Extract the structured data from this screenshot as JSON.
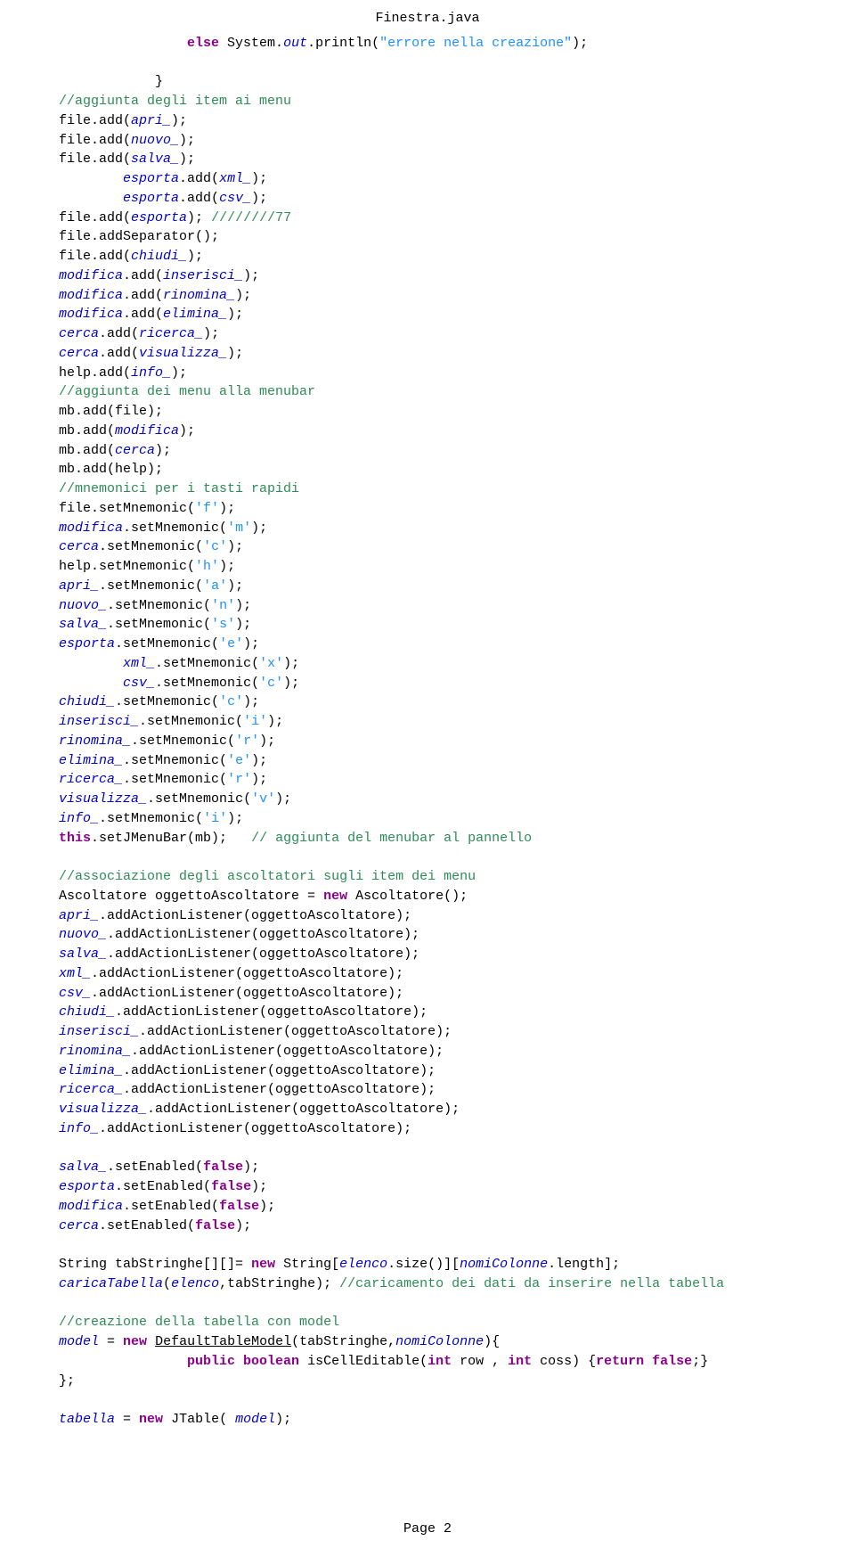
{
  "title": "Finestra.java",
  "footer": "Page 2",
  "code": {
    "lines": [
      {
        "indent": 5,
        "tokens": [
          {
            "t": "else",
            "c": "keyword"
          },
          {
            "t": " System."
          },
          {
            "t": "out",
            "c": "field"
          },
          {
            "t": ".println("
          },
          {
            "t": "\"errore nella creazione\"",
            "c": "string"
          },
          {
            "t": ");"
          }
        ]
      },
      {
        "indent": 0,
        "tokens": []
      },
      {
        "indent": 4,
        "tokens": [
          {
            "t": "}"
          }
        ]
      },
      {
        "indent": 1,
        "tokens": [
          {
            "t": "//aggiunta degli item ai menu",
            "c": "comment"
          }
        ]
      },
      {
        "indent": 1,
        "tokens": [
          {
            "t": "file.add("
          },
          {
            "t": "apri_",
            "c": "field"
          },
          {
            "t": ");"
          }
        ]
      },
      {
        "indent": 1,
        "tokens": [
          {
            "t": "file.add("
          },
          {
            "t": "nuovo_",
            "c": "field"
          },
          {
            "t": ");"
          }
        ]
      },
      {
        "indent": 1,
        "tokens": [
          {
            "t": "file.add("
          },
          {
            "t": "salva_",
            "c": "field"
          },
          {
            "t": ");"
          }
        ]
      },
      {
        "indent": 3,
        "tokens": [
          {
            "t": "esporta",
            "c": "field"
          },
          {
            "t": ".add("
          },
          {
            "t": "xml_",
            "c": "field"
          },
          {
            "t": ");"
          }
        ]
      },
      {
        "indent": 3,
        "tokens": [
          {
            "t": "esporta",
            "c": "field"
          },
          {
            "t": ".add("
          },
          {
            "t": "csv_",
            "c": "field"
          },
          {
            "t": ");"
          }
        ]
      },
      {
        "indent": 1,
        "tokens": [
          {
            "t": "file.add("
          },
          {
            "t": "esporta",
            "c": "field"
          },
          {
            "t": "); "
          },
          {
            "t": "////////77",
            "c": "comment"
          }
        ]
      },
      {
        "indent": 1,
        "tokens": [
          {
            "t": "file.addSeparator();"
          }
        ]
      },
      {
        "indent": 1,
        "tokens": [
          {
            "t": "file.add("
          },
          {
            "t": "chiudi_",
            "c": "field"
          },
          {
            "t": ");"
          }
        ]
      },
      {
        "indent": 1,
        "tokens": [
          {
            "t": "modifica",
            "c": "field"
          },
          {
            "t": ".add("
          },
          {
            "t": "inserisci_",
            "c": "field"
          },
          {
            "t": ");"
          }
        ]
      },
      {
        "indent": 1,
        "tokens": [
          {
            "t": "modifica",
            "c": "field"
          },
          {
            "t": ".add("
          },
          {
            "t": "rinomina_",
            "c": "field"
          },
          {
            "t": ");"
          }
        ]
      },
      {
        "indent": 1,
        "tokens": [
          {
            "t": "modifica",
            "c": "field"
          },
          {
            "t": ".add("
          },
          {
            "t": "elimina_",
            "c": "field"
          },
          {
            "t": ");"
          }
        ]
      },
      {
        "indent": 1,
        "tokens": [
          {
            "t": "cerca",
            "c": "field"
          },
          {
            "t": ".add("
          },
          {
            "t": "ricerca_",
            "c": "field"
          },
          {
            "t": ");"
          }
        ]
      },
      {
        "indent": 1,
        "tokens": [
          {
            "t": "cerca",
            "c": "field"
          },
          {
            "t": ".add("
          },
          {
            "t": "visualizza_",
            "c": "field"
          },
          {
            "t": ");"
          }
        ]
      },
      {
        "indent": 1,
        "tokens": [
          {
            "t": "help.add("
          },
          {
            "t": "info_",
            "c": "field"
          },
          {
            "t": ");"
          }
        ]
      },
      {
        "indent": 1,
        "tokens": [
          {
            "t": "//aggiunta dei menu alla menubar",
            "c": "comment"
          }
        ]
      },
      {
        "indent": 1,
        "tokens": [
          {
            "t": "mb.add(file);"
          }
        ]
      },
      {
        "indent": 1,
        "tokens": [
          {
            "t": "mb.add("
          },
          {
            "t": "modifica",
            "c": "field"
          },
          {
            "t": ");"
          }
        ]
      },
      {
        "indent": 1,
        "tokens": [
          {
            "t": "mb.add("
          },
          {
            "t": "cerca",
            "c": "field"
          },
          {
            "t": ");"
          }
        ]
      },
      {
        "indent": 1,
        "tokens": [
          {
            "t": "mb.add(help);"
          }
        ]
      },
      {
        "indent": 1,
        "tokens": [
          {
            "t": "//mnemonici per i tasti rapidi",
            "c": "comment"
          }
        ]
      },
      {
        "indent": 1,
        "tokens": [
          {
            "t": "file.setMnemonic("
          },
          {
            "t": "'f'",
            "c": "string"
          },
          {
            "t": ");"
          }
        ]
      },
      {
        "indent": 1,
        "tokens": [
          {
            "t": "modifica",
            "c": "field"
          },
          {
            "t": ".setMnemonic("
          },
          {
            "t": "'m'",
            "c": "string"
          },
          {
            "t": ");"
          }
        ]
      },
      {
        "indent": 1,
        "tokens": [
          {
            "t": "cerca",
            "c": "field"
          },
          {
            "t": ".setMnemonic("
          },
          {
            "t": "'c'",
            "c": "string"
          },
          {
            "t": ");"
          }
        ]
      },
      {
        "indent": 1,
        "tokens": [
          {
            "t": "help.setMnemonic("
          },
          {
            "t": "'h'",
            "c": "string"
          },
          {
            "t": ");"
          }
        ]
      },
      {
        "indent": 1,
        "tokens": [
          {
            "t": "apri_",
            "c": "field"
          },
          {
            "t": ".setMnemonic("
          },
          {
            "t": "'a'",
            "c": "string"
          },
          {
            "t": ");"
          }
        ]
      },
      {
        "indent": 1,
        "tokens": [
          {
            "t": "nuovo_",
            "c": "field"
          },
          {
            "t": ".setMnemonic("
          },
          {
            "t": "'n'",
            "c": "string"
          },
          {
            "t": ");"
          }
        ]
      },
      {
        "indent": 1,
        "tokens": [
          {
            "t": "salva_",
            "c": "field"
          },
          {
            "t": ".setMnemonic("
          },
          {
            "t": "'s'",
            "c": "string"
          },
          {
            "t": ");"
          }
        ]
      },
      {
        "indent": 1,
        "tokens": [
          {
            "t": "esporta",
            "c": "field"
          },
          {
            "t": ".setMnemonic("
          },
          {
            "t": "'e'",
            "c": "string"
          },
          {
            "t": ");"
          }
        ]
      },
      {
        "indent": 3,
        "tokens": [
          {
            "t": "xml_",
            "c": "field"
          },
          {
            "t": ".setMnemonic("
          },
          {
            "t": "'x'",
            "c": "string"
          },
          {
            "t": ");"
          }
        ]
      },
      {
        "indent": 3,
        "tokens": [
          {
            "t": "csv_",
            "c": "field"
          },
          {
            "t": ".setMnemonic("
          },
          {
            "t": "'c'",
            "c": "string"
          },
          {
            "t": ");"
          }
        ]
      },
      {
        "indent": 1,
        "tokens": [
          {
            "t": "chiudi_",
            "c": "field"
          },
          {
            "t": ".setMnemonic("
          },
          {
            "t": "'c'",
            "c": "string"
          },
          {
            "t": ");"
          }
        ]
      },
      {
        "indent": 1,
        "tokens": [
          {
            "t": "inserisci_",
            "c": "field"
          },
          {
            "t": ".setMnemonic("
          },
          {
            "t": "'i'",
            "c": "string"
          },
          {
            "t": ");"
          }
        ]
      },
      {
        "indent": 1,
        "tokens": [
          {
            "t": "rinomina_",
            "c": "field"
          },
          {
            "t": ".setMnemonic("
          },
          {
            "t": "'r'",
            "c": "string"
          },
          {
            "t": ");"
          }
        ]
      },
      {
        "indent": 1,
        "tokens": [
          {
            "t": "elimina_",
            "c": "field"
          },
          {
            "t": ".setMnemonic("
          },
          {
            "t": "'e'",
            "c": "string"
          },
          {
            "t": ");"
          }
        ]
      },
      {
        "indent": 1,
        "tokens": [
          {
            "t": "ricerca_",
            "c": "field"
          },
          {
            "t": ".setMnemonic("
          },
          {
            "t": "'r'",
            "c": "string"
          },
          {
            "t": ");"
          }
        ]
      },
      {
        "indent": 1,
        "tokens": [
          {
            "t": "visualizza_",
            "c": "field"
          },
          {
            "t": ".setMnemonic("
          },
          {
            "t": "'v'",
            "c": "string"
          },
          {
            "t": ");"
          }
        ]
      },
      {
        "indent": 1,
        "tokens": [
          {
            "t": "info_",
            "c": "field"
          },
          {
            "t": ".setMnemonic("
          },
          {
            "t": "'i'",
            "c": "string"
          },
          {
            "t": ");"
          }
        ]
      },
      {
        "indent": 1,
        "tokens": [
          {
            "t": "this",
            "c": "keyword"
          },
          {
            "t": ".setJMenuBar(mb);   "
          },
          {
            "t": "// aggiunta del menubar al pannello",
            "c": "comment"
          }
        ]
      },
      {
        "indent": 0,
        "tokens": []
      },
      {
        "indent": 1,
        "tokens": [
          {
            "t": "//associazione degli ascoltatori sugli item dei menu",
            "c": "comment"
          }
        ]
      },
      {
        "indent": 1,
        "tokens": [
          {
            "t": "Ascoltatore oggettoAscoltatore = "
          },
          {
            "t": "new",
            "c": "keyword"
          },
          {
            "t": " Ascoltatore();"
          }
        ]
      },
      {
        "indent": 1,
        "tokens": [
          {
            "t": "apri_",
            "c": "field"
          },
          {
            "t": ".addActionListener(oggettoAscoltatore);"
          }
        ]
      },
      {
        "indent": 1,
        "tokens": [
          {
            "t": "nuovo_",
            "c": "field"
          },
          {
            "t": ".addActionListener(oggettoAscoltatore);"
          }
        ]
      },
      {
        "indent": 1,
        "tokens": [
          {
            "t": "salva_",
            "c": "field"
          },
          {
            "t": ".addActionListener(oggettoAscoltatore);"
          }
        ]
      },
      {
        "indent": 1,
        "tokens": [
          {
            "t": "xml_",
            "c": "field"
          },
          {
            "t": ".addActionListener(oggettoAscoltatore);"
          }
        ]
      },
      {
        "indent": 1,
        "tokens": [
          {
            "t": "csv_",
            "c": "field"
          },
          {
            "t": ".addActionListener(oggettoAscoltatore);"
          }
        ]
      },
      {
        "indent": 1,
        "tokens": [
          {
            "t": "chiudi_",
            "c": "field"
          },
          {
            "t": ".addActionListener(oggettoAscoltatore);"
          }
        ]
      },
      {
        "indent": 1,
        "tokens": [
          {
            "t": "inserisci_",
            "c": "field"
          },
          {
            "t": ".addActionListener(oggettoAscoltatore);"
          }
        ]
      },
      {
        "indent": 1,
        "tokens": [
          {
            "t": "rinomina_",
            "c": "field"
          },
          {
            "t": ".addActionListener(oggettoAscoltatore);"
          }
        ]
      },
      {
        "indent": 1,
        "tokens": [
          {
            "t": "elimina_",
            "c": "field"
          },
          {
            "t": ".addActionListener(oggettoAscoltatore);"
          }
        ]
      },
      {
        "indent": 1,
        "tokens": [
          {
            "t": "ricerca_",
            "c": "field"
          },
          {
            "t": ".addActionListener(oggettoAscoltatore);"
          }
        ]
      },
      {
        "indent": 1,
        "tokens": [
          {
            "t": "visualizza_",
            "c": "field"
          },
          {
            "t": ".addActionListener(oggettoAscoltatore);"
          }
        ]
      },
      {
        "indent": 1,
        "tokens": [
          {
            "t": "info_",
            "c": "field"
          },
          {
            "t": ".addActionListener(oggettoAscoltatore);"
          }
        ]
      },
      {
        "indent": 0,
        "tokens": []
      },
      {
        "indent": 1,
        "tokens": [
          {
            "t": "salva_",
            "c": "field"
          },
          {
            "t": ".setEnabled("
          },
          {
            "t": "false",
            "c": "keyword"
          },
          {
            "t": ");"
          }
        ]
      },
      {
        "indent": 1,
        "tokens": [
          {
            "t": "esporta",
            "c": "field"
          },
          {
            "t": ".setEnabled("
          },
          {
            "t": "false",
            "c": "keyword"
          },
          {
            "t": ");"
          }
        ]
      },
      {
        "indent": 1,
        "tokens": [
          {
            "t": "modifica",
            "c": "field"
          },
          {
            "t": ".setEnabled("
          },
          {
            "t": "false",
            "c": "keyword"
          },
          {
            "t": ");"
          }
        ]
      },
      {
        "indent": 1,
        "tokens": [
          {
            "t": "cerca",
            "c": "field"
          },
          {
            "t": ".setEnabled("
          },
          {
            "t": "false",
            "c": "keyword"
          },
          {
            "t": ");"
          }
        ]
      },
      {
        "indent": 0,
        "tokens": []
      },
      {
        "indent": 1,
        "tokens": [
          {
            "t": "String tabStringhe[][]= "
          },
          {
            "t": "new",
            "c": "keyword"
          },
          {
            "t": " String["
          },
          {
            "t": "elenco",
            "c": "field"
          },
          {
            "t": ".size()]["
          },
          {
            "t": "nomiColonne",
            "c": "field"
          },
          {
            "t": ".length];"
          }
        ]
      },
      {
        "indent": 1,
        "tokens": [
          {
            "t": "caricaTabella",
            "c": "field"
          },
          {
            "t": "("
          },
          {
            "t": "elenco",
            "c": "field"
          },
          {
            "t": ",tabStringhe); "
          },
          {
            "t": "//caricamento dei dati da inserire nella tabella",
            "c": "comment"
          }
        ]
      },
      {
        "indent": 0,
        "tokens": []
      },
      {
        "indent": 1,
        "tokens": [
          {
            "t": "//creazione della tabella con model",
            "c": "comment"
          }
        ]
      },
      {
        "indent": 1,
        "tokens": [
          {
            "t": "model",
            "c": "field"
          },
          {
            "t": " = "
          },
          {
            "t": "new",
            "c": "keyword"
          },
          {
            "t": " "
          },
          {
            "t": "DefaultTableModel",
            "c": "type"
          },
          {
            "t": "(tabStringhe,"
          },
          {
            "t": "nomiColonne",
            "c": "field"
          },
          {
            "t": "){"
          }
        ]
      },
      {
        "indent": 5,
        "tokens": [
          {
            "t": "public boolean",
            "c": "keyword"
          },
          {
            "t": " isCellEditable("
          },
          {
            "t": "int",
            "c": "keyword"
          },
          {
            "t": " row , "
          },
          {
            "t": "int",
            "c": "keyword"
          },
          {
            "t": " coss) {"
          },
          {
            "t": "return false",
            "c": "keyword"
          },
          {
            "t": ";}"
          }
        ]
      },
      {
        "indent": 1,
        "tokens": [
          {
            "t": "};"
          }
        ]
      },
      {
        "indent": 0,
        "tokens": []
      },
      {
        "indent": 1,
        "tokens": [
          {
            "t": "tabella",
            "c": "field"
          },
          {
            "t": " = "
          },
          {
            "t": "new",
            "c": "keyword"
          },
          {
            "t": " JTable( "
          },
          {
            "t": "model",
            "c": "field"
          },
          {
            "t": ");"
          }
        ]
      }
    ]
  }
}
